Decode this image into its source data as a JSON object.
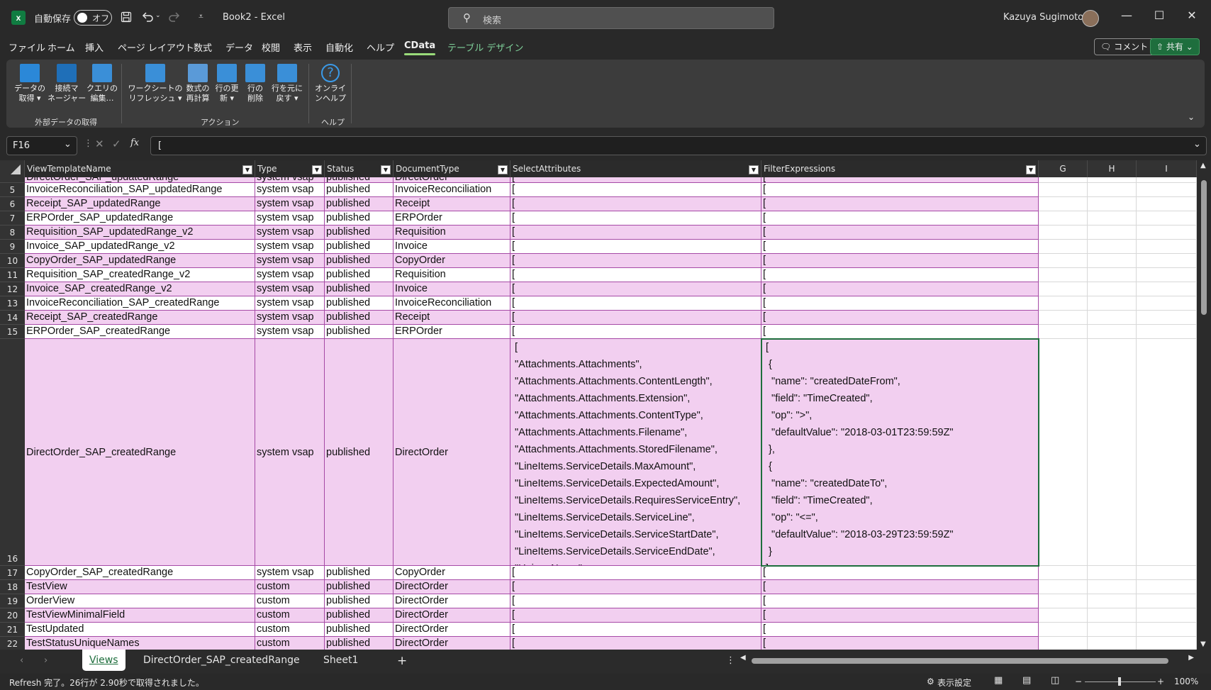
{
  "titlebar": {
    "autosave_label": "自動保存",
    "autosave_state": "オフ",
    "save_icon": "save-icon",
    "undo_icon": "undo-icon",
    "redo_icon": "redo-icon",
    "qat_more": "⩡",
    "title": "Book2  -  Excel",
    "search_placeholder": "検索",
    "user_name": "Kazuya Sugimoto",
    "minimize": "—",
    "maximize": "☐",
    "close": "✕"
  },
  "tabs": [
    "ファイル",
    "ホーム",
    "挿入",
    "ページ レイアウト",
    "数式",
    "データ",
    "校閲",
    "表示",
    "自動化",
    "ヘルプ",
    "CData",
    "テーブル デザイン"
  ],
  "active_tab": "CData",
  "comment_button": "コメント",
  "share_button": "共有",
  "ribbon": {
    "groups": {
      "external_data": "外部データの取得",
      "actions": "アクション",
      "help": "ヘルプ"
    },
    "buttons": {
      "get_data": "データの\n取得 ▾",
      "connection_manager": "接続マ\nネージャー",
      "query_edit": "クエリの\n編集…",
      "refresh_sheet": "ワークシートの\nリフレッシュ ▾",
      "recalc": "数式の\n再計算",
      "update_row": "行の更\n新 ▾",
      "delete_row": "行の\n削除",
      "revert_row": "行を元に\n戻す ▾",
      "online_help": "オンライ\nンヘルプ"
    }
  },
  "formula_bar": {
    "name_box": "F16",
    "fx": "fx",
    "value": "["
  },
  "columns": {
    "headers": [
      "ViewTemplateName",
      "Type",
      "Status",
      "DocumentType",
      "SelectAttributes",
      "FilterExpressions"
    ],
    "extra": [
      "G",
      "H",
      "I"
    ]
  },
  "rows": [
    {
      "n": "",
      "name": "DirectOrder_SAP_updatedRange",
      "type": "system vsap",
      "status": "published",
      "doc": "DirectOrder",
      "sel": "[",
      "filter": "["
    },
    {
      "n": "5",
      "name": "InvoiceReconciliation_SAP_updatedRange",
      "type": "system vsap",
      "status": "published",
      "doc": "InvoiceReconciliation",
      "sel": "[",
      "filter": "["
    },
    {
      "n": "6",
      "name": "Receipt_SAP_updatedRange",
      "type": "system vsap",
      "status": "published",
      "doc": "Receipt",
      "sel": "[",
      "filter": "["
    },
    {
      "n": "7",
      "name": "ERPOrder_SAP_updatedRange",
      "type": "system vsap",
      "status": "published",
      "doc": "ERPOrder",
      "sel": "[",
      "filter": "["
    },
    {
      "n": "8",
      "name": "Requisition_SAP_updatedRange_v2",
      "type": "system vsap",
      "status": "published",
      "doc": "Requisition",
      "sel": "[",
      "filter": "["
    },
    {
      "n": "9",
      "name": "Invoice_SAP_updatedRange_v2",
      "type": "system vsap",
      "status": "published",
      "doc": "Invoice",
      "sel": "[",
      "filter": "["
    },
    {
      "n": "10",
      "name": "CopyOrder_SAP_updatedRange",
      "type": "system vsap",
      "status": "published",
      "doc": "CopyOrder",
      "sel": "[",
      "filter": "["
    },
    {
      "n": "11",
      "name": "Requisition_SAP_createdRange_v2",
      "type": "system vsap",
      "status": "published",
      "doc": "Requisition",
      "sel": "[",
      "filter": "["
    },
    {
      "n": "12",
      "name": "Invoice_SAP_createdRange_v2",
      "type": "system vsap",
      "status": "published",
      "doc": "Invoice",
      "sel": "[",
      "filter": "["
    },
    {
      "n": "13",
      "name": "InvoiceReconciliation_SAP_createdRange",
      "type": "system vsap",
      "status": "published",
      "doc": "InvoiceReconciliation",
      "sel": "[",
      "filter": "["
    },
    {
      "n": "14",
      "name": "Receipt_SAP_createdRange",
      "type": "system vsap",
      "status": "published",
      "doc": "Receipt",
      "sel": "[",
      "filter": "["
    },
    {
      "n": "15",
      "name": "ERPOrder_SAP_createdRange",
      "type": "system vsap",
      "status": "published",
      "doc": "ERPOrder",
      "sel": "[",
      "filter": "["
    },
    {
      "n": "16",
      "name": "DirectOrder_SAP_createdRange",
      "type": "system vsap",
      "status": "published",
      "doc": "DirectOrder",
      "sel": "[\n\"Attachments.Attachments\",\n\"Attachments.Attachments.ContentLength\",\n\"Attachments.Attachments.Extension\",\n\"Attachments.Attachments.ContentType\",\n\"Attachments.Attachments.Filename\",\n\"Attachments.Attachments.StoredFilename\",\n\"LineItems.ServiceDetails.MaxAmount\",\n\"LineItems.ServiceDetails.ExpectedAmount\",\n\"LineItems.ServiceDetails.RequiresServiceEntry\",\n\"LineItems.ServiceDetails.ServiceLine\",\n\"LineItems.ServiceDetails.ServiceStartDate\",\n\"LineItems.ServiceDetails.ServiceEndDate\",\n\"UniqueName\"",
      "filter": "[\n {\n  \"name\": \"createdDateFrom\",\n  \"field\": \"TimeCreated\",\n  \"op\": \">\",\n  \"defaultValue\": \"2018-03-01T23:59:59Z\"\n },\n {\n  \"name\": \"createdDateTo\",\n  \"field\": \"TimeCreated\",\n  \"op\": \"<=\",\n  \"defaultValue\": \"2018-03-29T23:59:59Z\"\n }\n]"
    },
    {
      "n": "17",
      "name": "CopyOrder_SAP_createdRange",
      "type": "system vsap",
      "status": "published",
      "doc": "CopyOrder",
      "sel": "[",
      "filter": "["
    },
    {
      "n": "18",
      "name": "TestView",
      "type": "custom",
      "status": "published",
      "doc": "DirectOrder",
      "sel": "[",
      "filter": "["
    },
    {
      "n": "19",
      "name": "OrderView",
      "type": "custom",
      "status": "published",
      "doc": "DirectOrder",
      "sel": "[",
      "filter": "["
    },
    {
      "n": "20",
      "name": "TestViewMinimalField",
      "type": "custom",
      "status": "published",
      "doc": "DirectOrder",
      "sel": "[",
      "filter": "["
    },
    {
      "n": "21",
      "name": "TestUpdated",
      "type": "custom",
      "status": "published",
      "doc": "DirectOrder",
      "sel": "[",
      "filter": "["
    },
    {
      "n": "22",
      "name": "TestStatusUniqueNames",
      "type": "custom",
      "status": "published",
      "doc": "DirectOrder",
      "sel": "[",
      "filter": "["
    }
  ],
  "sheets": [
    "Views",
    "DirectOrder_SAP_createdRange",
    "Sheet1"
  ],
  "active_sheet": "Views",
  "add_sheet": "+",
  "status": {
    "message": "Refresh 完了。26行が 2.90秒で取得されました。",
    "display_settings": "表示設定",
    "zoom": "100%"
  },
  "colors": {
    "accent": "#1e6e3d",
    "table_band": "#f2cff0",
    "table_border": "#a64aa6"
  }
}
